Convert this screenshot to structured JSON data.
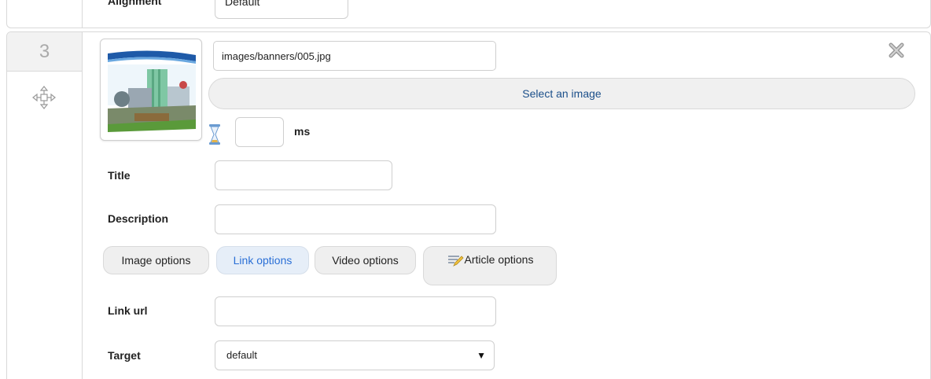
{
  "previous_slide": {
    "label": "Alignment",
    "value": "Default"
  },
  "slide": {
    "number": "3",
    "image_path": "images/banners/005.jpg",
    "select_image_label": "Select an image",
    "duration_value": "",
    "duration_unit": "ms",
    "fields": {
      "title_label": "Title",
      "title_value": "",
      "description_label": "Description",
      "description_value": ""
    },
    "tabs": [
      {
        "label": "Image options",
        "active": false
      },
      {
        "label": "Link options",
        "active": true
      },
      {
        "label": "Video options",
        "active": false
      },
      {
        "label": "Article options",
        "active": false,
        "icon": "pen-icon"
      }
    ],
    "link": {
      "url_label": "Link url",
      "url_value": "",
      "target_label": "Target",
      "target_value": "default"
    },
    "icons": {
      "move": "move-icon",
      "delete": "close-icon",
      "duration": "hourglass-icon"
    }
  },
  "colors": {
    "link_blue": "#2a6fd6",
    "button_text": "#1b4f8a",
    "border": "#d9d9d9"
  }
}
